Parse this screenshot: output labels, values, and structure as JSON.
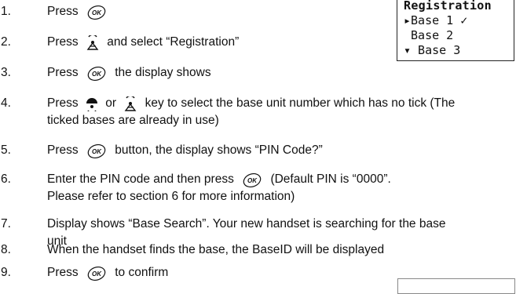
{
  "steps": [
    {
      "num": "1.",
      "parts": [
        "Press",
        "ok-icon"
      ]
    },
    {
      "num": "2.",
      "parts": [
        "Press",
        "nav-down-icon",
        "and select “Registration”"
      ]
    },
    {
      "num": "3.",
      "parts": [
        "Press",
        "ok-icon",
        "the display shows"
      ]
    },
    {
      "num": "4.",
      "line1": [
        "Press",
        "nav-up-icon",
        "or",
        "nav-down-icon",
        "key to select the base unit number which has no tick (The"
      ],
      "line2": "ticked bases are already in use)"
    },
    {
      "num": "5.",
      "parts": [
        "Press",
        "ok-icon",
        "button, the display shows “PIN Code?”"
      ]
    },
    {
      "num": "6.",
      "line1": [
        "Enter the PIN code and then press",
        "ok-icon",
        "(Default PIN is “0000”."
      ],
      "line2": "Please refer to section 6 for more information)"
    },
    {
      "num": "7.",
      "line1_text": "Display shows “Base Search”. Your new handset is searching for the base",
      "line2": "unit"
    },
    {
      "num": "8.",
      "text": "When the handset finds the base, the BaseID will be displayed"
    },
    {
      "num": "9.",
      "parts": [
        "Press",
        "ok-icon",
        "to confirm"
      ]
    }
  ],
  "display": {
    "title": "Registration",
    "rows": [
      "▸Base 1 ✓",
      " Base 2",
      "▾ Base 3"
    ]
  },
  "icons": {
    "ok": "ok-key-icon",
    "nav_down": "nav-down-key-icon",
    "nav_up": "nav-up-key-icon"
  }
}
